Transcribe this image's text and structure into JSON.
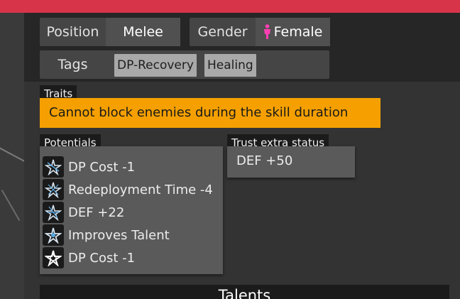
{
  "profile": {
    "position": {
      "label": "Position",
      "value": "Melee"
    },
    "gender": {
      "label": "Gender",
      "icon": "female-icon",
      "icon_color": "#ff3fb4",
      "value": "Female"
    },
    "tags": {
      "label": "Tags",
      "items": [
        "DP-Recovery",
        "Healing"
      ]
    }
  },
  "traits": {
    "title": "Traits",
    "text": "Cannot block enemies during the skill duration",
    "color": "#f5a000"
  },
  "potentials": {
    "title": "Potentials",
    "items": [
      {
        "icon": "potential-1-icon",
        "text": "DP Cost -1"
      },
      {
        "icon": "potential-2-icon",
        "text": "Redeployment Time -4"
      },
      {
        "icon": "potential-3-icon",
        "text": "DEF +22"
      },
      {
        "icon": "potential-4-icon",
        "text": "Improves Talent"
      },
      {
        "icon": "potential-5-icon",
        "text": "DP Cost -1"
      }
    ]
  },
  "trust": {
    "title": "Trust extra status",
    "value": "DEF +50"
  },
  "talents": {
    "title": "Talents"
  },
  "colors": {
    "accent_bar": "#d7344a",
    "trait_highlight": "#f5a000"
  }
}
